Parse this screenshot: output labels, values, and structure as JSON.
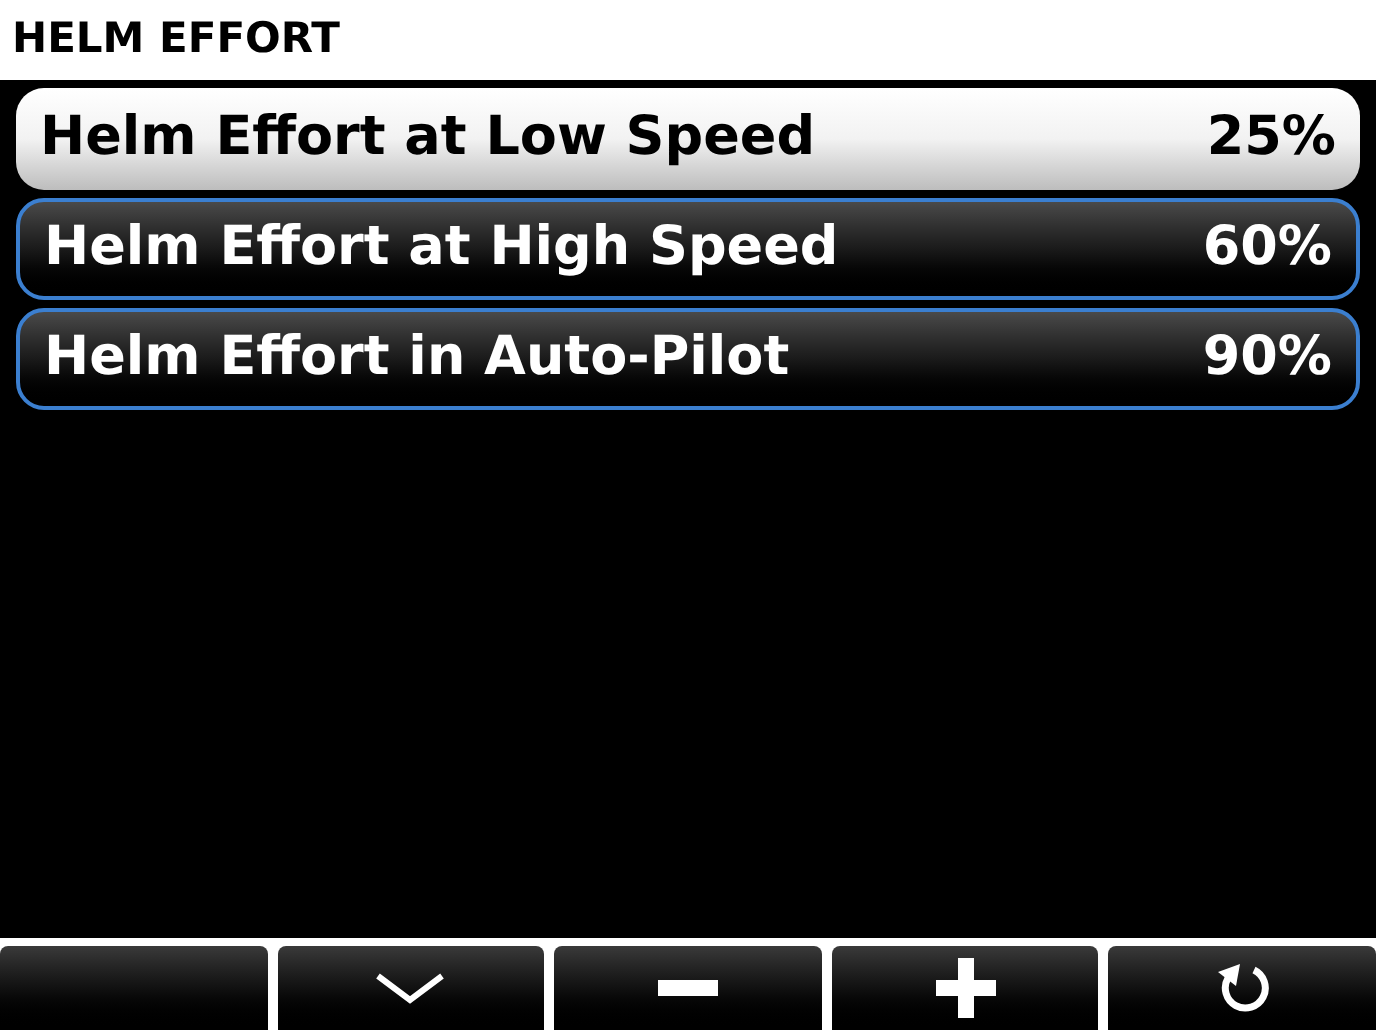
{
  "title": "HELM EFFORT",
  "items": [
    {
      "label": "Helm Effort at Low Speed",
      "value": "25%",
      "selected": true
    },
    {
      "label": "Helm Effort at High Speed",
      "value": "60%",
      "selected": false
    },
    {
      "label": "Helm Effort in Auto-Pilot",
      "value": "90%",
      "selected": false
    }
  ],
  "softkeys": [
    {
      "kind": "blank"
    },
    {
      "kind": "down"
    },
    {
      "kind": "minus"
    },
    {
      "kind": "plus"
    },
    {
      "kind": "back"
    }
  ]
}
